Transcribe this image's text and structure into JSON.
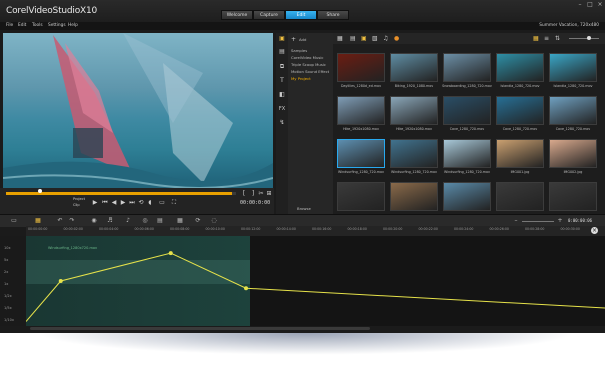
{
  "app": {
    "logo_prefix": "Corel",
    "logo_name": "VideoStudio",
    "logo_version": "X10",
    "project_name": "Summer Vacation, 720x480"
  },
  "workspace_tabs": [
    {
      "label": "Welcome",
      "active": false
    },
    {
      "label": "Capture",
      "active": false
    },
    {
      "label": "Edit",
      "active": true
    },
    {
      "label": "Share",
      "active": false
    }
  ],
  "menu": [
    "File",
    "Edit",
    "Tools",
    "Settings",
    "Help"
  ],
  "player": {
    "mode_project": "Project",
    "mode_clip": "Clip",
    "timecode": "00:00:0:00",
    "playhead_fraction": 0.14
  },
  "library": {
    "add_label": "Add",
    "folders": [
      {
        "label": "Samples",
        "selected": false
      },
      {
        "label": "CorelVideo Music",
        "selected": false
      },
      {
        "label": "Triple Scoop Music",
        "selected": false
      },
      {
        "label": "Motion Sound Effect",
        "selected": false
      },
      {
        "label": "My Project",
        "selected": true
      }
    ],
    "browse_label": "Browse",
    "thumbs": [
      {
        "label": "Daylilies_1280d_ed.mov",
        "color": "#6b1d12",
        "selected": false
      },
      {
        "label": "Biking_1920_1080.mov",
        "color": "#5f8da3",
        "selected": false
      },
      {
        "label": "Snowboarding_1280_720.mov",
        "color": "#6c8fa6",
        "selected": false
      },
      {
        "label": "Islandia_1280_720.mov",
        "color": "#2e8fa6",
        "selected": false
      },
      {
        "label": "Islandia_1280_720.mov",
        "color": "#3aa6c6",
        "selected": false
      },
      {
        "label": "Hike_1920x1080.mov",
        "color": "#7f9db6",
        "selected": false
      },
      {
        "label": "Hike_1920x1080.mov",
        "color": "#8aa6b8",
        "selected": false
      },
      {
        "label": "Cave_1280_720.mov",
        "color": "#2a4e66",
        "selected": false
      },
      {
        "label": "Cave_1280_720.mov",
        "color": "#276f95",
        "selected": false
      },
      {
        "label": "Cave_1280_720.mov",
        "color": "#6fa0c0",
        "selected": false
      },
      {
        "label": "Windsurfing_1280_720.mov",
        "color": "#5d8fb0",
        "selected": true
      },
      {
        "label": "Windsurfing_1280_720.mov",
        "color": "#41738f",
        "selected": false
      },
      {
        "label": "Windsurfing_1280_720.mov",
        "color": "#a8c8d8",
        "selected": false
      },
      {
        "label": "IMG001.jpg",
        "color": "#caa070",
        "selected": false
      },
      {
        "label": "IMG002.jpg",
        "color": "#d8a98d",
        "selected": false
      },
      {
        "label": "",
        "color": "#3a3a3a",
        "selected": false
      },
      {
        "label": "",
        "color": "#8a6a4a",
        "selected": false
      },
      {
        "label": "",
        "color": "#5a8aa8",
        "selected": false
      },
      {
        "label": "",
        "color": "#3a3a3a",
        "selected": false
      },
      {
        "label": "",
        "color": "#3a3a3a",
        "selected": false
      }
    ]
  },
  "timeline": {
    "timecode": "0:00:00:06",
    "ruler_ticks": [
      "00:00:00:00",
      "00:00:02:00",
      "00:00:04:00",
      "00:00:06:00",
      "00:00:08:00",
      "00:00:10:00",
      "00:00:12:00",
      "00:00:14:00",
      "00:00:16:00",
      "00:00:18:00",
      "00:00:20:00",
      "00:00:22:00",
      "00:00:24:00",
      "00:00:26:00",
      "00:00:28:00",
      "00:00:30:00"
    ],
    "clip_label": "Windsurfing_1280x720.mov",
    "y_labels": [
      "10x",
      "5x",
      "2x",
      "1x",
      "1/2x",
      "1/5x",
      "1/10x"
    ],
    "speed_keyframes": [
      {
        "t": 0,
        "v": 0.05
      },
      {
        "t": 0.06,
        "v": 0.5
      },
      {
        "t": 0.25,
        "v": 0.81
      },
      {
        "t": 0.38,
        "v": 0.42
      },
      {
        "t": 1.0,
        "v": 0.2
      }
    ]
  },
  "colors": {
    "accent": "#1a9de0",
    "graph": "#e6e24a",
    "scrub": "#e8a000"
  }
}
